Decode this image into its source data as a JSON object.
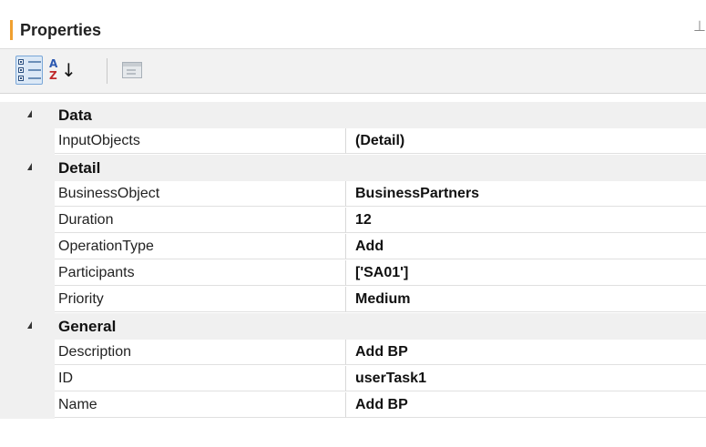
{
  "panel": {
    "title": "Properties",
    "accent_color": "#f0a030",
    "pin_icon": "pin-icon"
  },
  "toolbar": {
    "buttons": [
      {
        "name": "categorized-view-button",
        "icon": "categorized-list-icon",
        "active": true
      },
      {
        "name": "alphabetical-sort-button",
        "icon": "sort-az-icon",
        "label_a": "A",
        "label_z": "Z",
        "arrow": "↓",
        "active": false
      },
      {
        "name": "property-pages-button",
        "icon": "property-pages-icon",
        "active": false,
        "enabled": false
      }
    ]
  },
  "categories": [
    {
      "label": "Data",
      "expanded": true,
      "properties": [
        {
          "name": "InputObjects",
          "value": "(Detail)"
        }
      ]
    },
    {
      "label": "Detail",
      "expanded": true,
      "properties": [
        {
          "name": "BusinessObject",
          "value": "BusinessPartners"
        },
        {
          "name": "Duration",
          "value": "12"
        },
        {
          "name": "OperationType",
          "value": "Add"
        },
        {
          "name": "Participants",
          "value": "['SA01']"
        },
        {
          "name": "Priority",
          "value": "Medium"
        }
      ]
    },
    {
      "label": "General",
      "expanded": true,
      "properties": [
        {
          "name": "Description",
          "value": "Add BP"
        },
        {
          "name": "ID",
          "value": "userTask1"
        },
        {
          "name": "Name",
          "value": "Add BP"
        }
      ]
    }
  ]
}
